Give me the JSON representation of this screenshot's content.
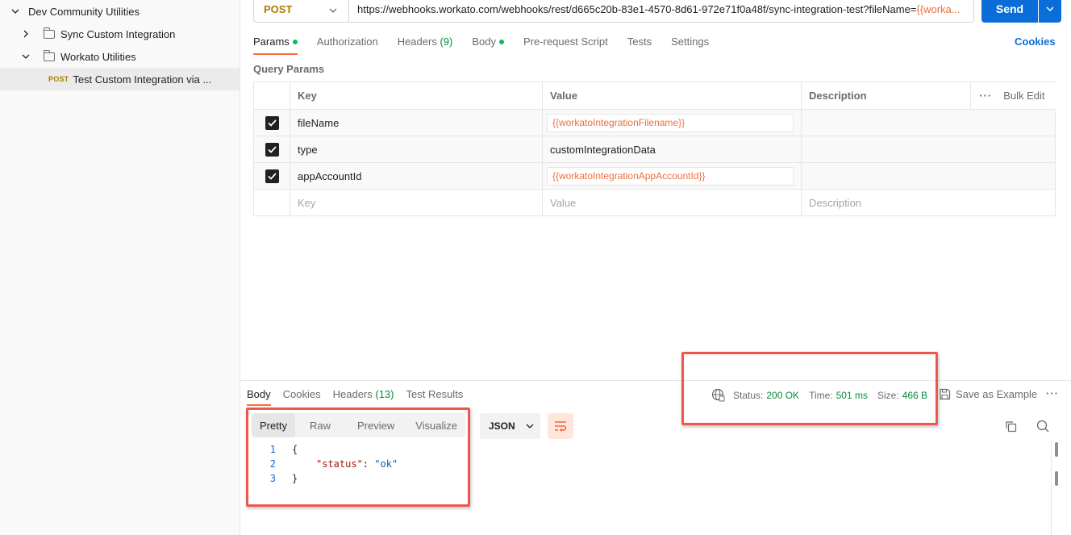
{
  "sidebar": {
    "items": [
      {
        "label": "Dev Community Utilities"
      },
      {
        "label": "Sync Custom Integration"
      },
      {
        "label": "Workato Utilities"
      },
      {
        "method": "POST",
        "label": "Test Custom Integration via ..."
      }
    ]
  },
  "request": {
    "method": "POST",
    "url_base": "https://webhooks.workato.com/webhooks/rest/d665c20b-83e1-4570-8d61-972e71f0a48f/sync-integration-test?fileName=",
    "url_var": "{{worka...",
    "send_label": "Send"
  },
  "req_tabs": {
    "params": "Params",
    "authorization": "Authorization",
    "headers": "Headers",
    "headers_count": "(9)",
    "body": "Body",
    "prerequest": "Pre-request Script",
    "tests": "Tests",
    "settings": "Settings",
    "cookies": "Cookies"
  },
  "query_params": {
    "title": "Query Params",
    "headers": {
      "key": "Key",
      "value": "Value",
      "description": "Description",
      "bulk_edit": "Bulk Edit"
    },
    "rows": [
      {
        "key": "fileName",
        "value": "{{workatoIntegrationFilename}}",
        "description": ""
      },
      {
        "key": "type",
        "value": "customIntegrationData",
        "description": ""
      },
      {
        "key": "appAccountId",
        "value": "{{workatoIntegrationAppAccountId}}",
        "description": ""
      }
    ],
    "placeholder": {
      "key": "Key",
      "value": "Value",
      "description": "Description"
    }
  },
  "response": {
    "tabs": {
      "body": "Body",
      "cookies": "Cookies",
      "headers": "Headers",
      "headers_count": "(13)",
      "test_results": "Test Results"
    },
    "status_label": "Status:",
    "status_value": "200 OK",
    "time_label": "Time:",
    "time_value": "501 ms",
    "size_label": "Size:",
    "size_value": "466 B",
    "save_example": "Save as Example",
    "views": {
      "pretty": "Pretty",
      "raw": "Raw",
      "preview": "Preview",
      "visualize": "Visualize"
    },
    "format": "JSON",
    "code": {
      "lines": [
        {
          "n": "1",
          "text": "{"
        },
        {
          "n": "2",
          "key": "\"status\"",
          "colon": ": ",
          "value": "\"ok\""
        },
        {
          "n": "3",
          "text": "}"
        }
      ]
    }
  },
  "colors": {
    "accent": "#ff6c37",
    "send": "#0b6ed8",
    "status_ok": "#0a8a3c",
    "highlight": "#f0574b",
    "variable": "#eb6f3c"
  }
}
